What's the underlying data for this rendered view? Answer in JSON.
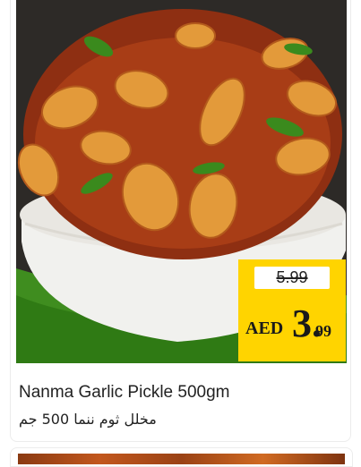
{
  "product": {
    "name_en": "Nanma Garlic Pickle 500gm",
    "name_ar": "مخلل ثوم ننما 500 جم",
    "image_alt_icon": "product-photo"
  },
  "price": {
    "old": "5.99",
    "currency": "AED",
    "new_int": "3.",
    "new_dec": "99"
  },
  "colors": {
    "price_tag": "#ffd400",
    "photo_bg": "#2b2b2b",
    "leaf": "#3a8a1d",
    "bowl": "#f2f2ef",
    "pickle": "#b8491a"
  }
}
